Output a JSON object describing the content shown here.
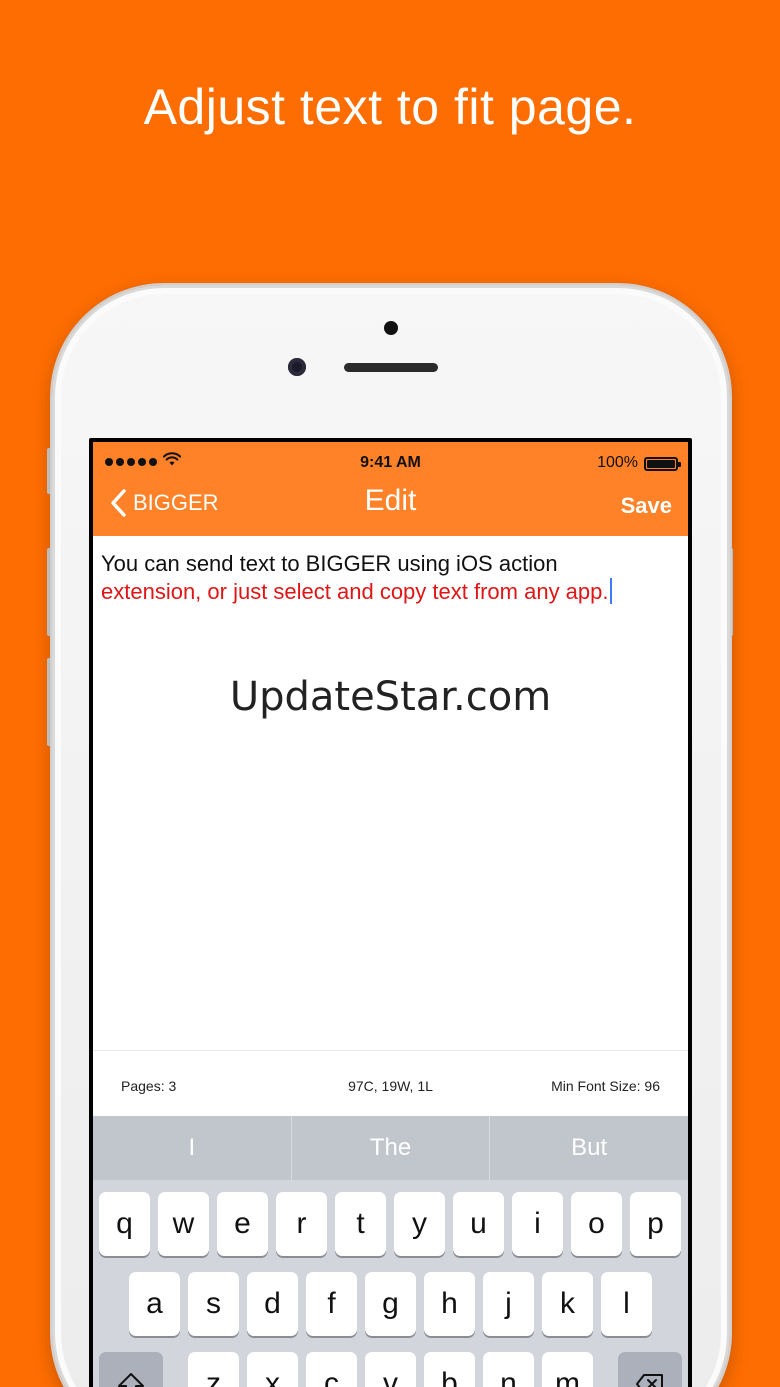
{
  "headline": "Adjust text to fit page.",
  "status_bar": {
    "time": "9:41 AM",
    "battery": "100%",
    "signal_icon": "signal-dots-icon",
    "wifi_icon": "wifi-icon",
    "battery_icon": "battery-icon"
  },
  "nav": {
    "back_label": "BIGGER",
    "title": "Edit",
    "save_label": "Save",
    "bar_color": "#ff8128"
  },
  "editor": {
    "line1": "You can send text to BIGGER using iOS action",
    "line2": "extension, or just select and copy text from any app.",
    "line2_color": "#e01616"
  },
  "watermark": "UpdateStar.com",
  "stats": {
    "pages": "Pages: 3",
    "counts": "97C, 19W, 1L",
    "min_font": "Min Font Size: 96"
  },
  "keyboard": {
    "suggestions": [
      "I",
      "The",
      "But"
    ],
    "row1": [
      "q",
      "w",
      "e",
      "r",
      "t",
      "y",
      "u",
      "i",
      "o",
      "p"
    ],
    "row2": [
      "a",
      "s",
      "d",
      "f",
      "g",
      "h",
      "j",
      "k",
      "l"
    ],
    "row3": [
      "z",
      "x",
      "c",
      "v",
      "b",
      "n",
      "m"
    ],
    "shift_icon": "shift-icon",
    "delete_icon": "delete-icon"
  },
  "colors": {
    "background": "#fd6d01",
    "accent": "#ff8128"
  }
}
